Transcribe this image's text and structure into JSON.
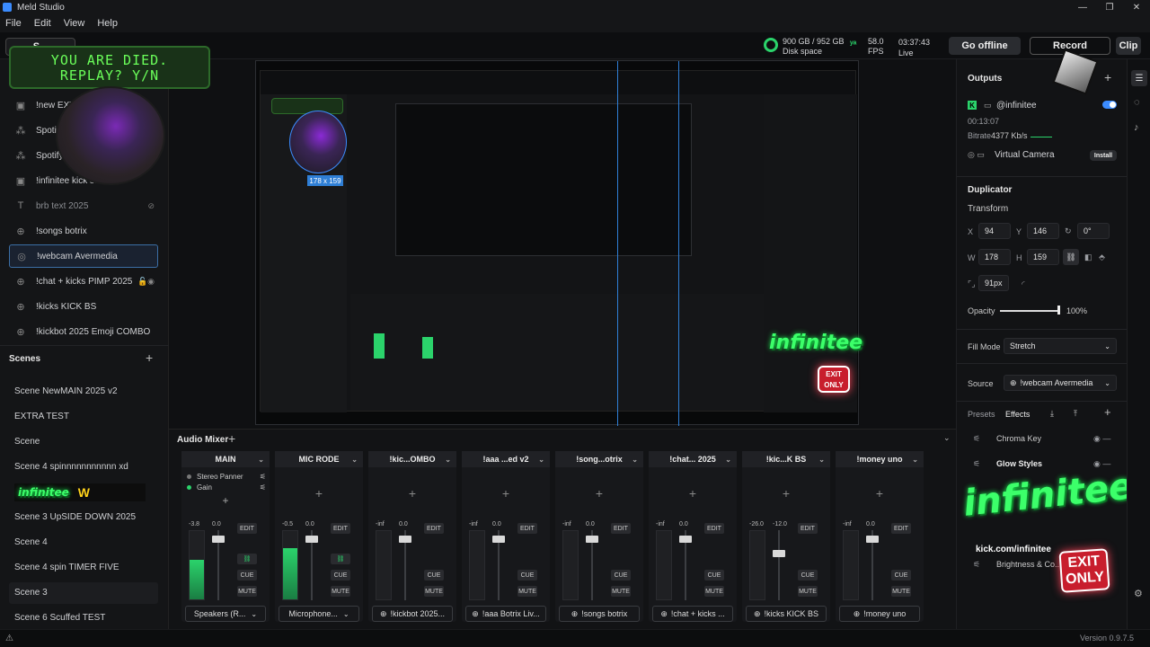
{
  "app": {
    "title": "Meld Studio"
  },
  "window_controls": [
    "—",
    "❐",
    "✕"
  ],
  "menu": [
    "File",
    "Edit",
    "View",
    "Help"
  ],
  "topbar": {
    "scene_button": "S...",
    "disk_value": "900 GB / 952 GB",
    "disk_label": "Disk space",
    "fps_value": "58.0",
    "fps_label": "FPS",
    "live_time": "03:37:43",
    "live_label": "Live",
    "go_offline": "Go offline",
    "record": "Record",
    "clip": "Clip"
  },
  "overlay": {
    "game_over_line1": "YOU ARE DIED.",
    "game_over_line2": "REPLAY? Y/N",
    "brand_text": "infinitee",
    "brand_url": "kick.com/infinitee",
    "exit_line1": "EXIT",
    "exit_line2": "ONLY"
  },
  "sources": [
    {
      "label": "!new EXTRA...",
      "icon": "layers-icon"
    },
    {
      "label": "Spotify",
      "icon": "grid-icon"
    },
    {
      "label": "Spotify...",
      "icon": "grid-icon"
    },
    {
      "label": "!infinitee kick sub...",
      "icon": "layers-icon"
    },
    {
      "label": "brb text 2025",
      "icon": "text-icon"
    },
    {
      "label": "!songs botrix",
      "icon": "globe-icon"
    },
    {
      "label": "!webcam Avermedia",
      "icon": "camera-icon"
    },
    {
      "label": "!chat + kicks PIMP 2025",
      "icon": "globe-icon"
    },
    {
      "label": "!kicks KICK BS",
      "icon": "globe-icon"
    },
    {
      "label": "!kickbot 2025 Emoji COMBO",
      "icon": "globe-icon"
    }
  ],
  "scenes": {
    "title": "Scenes",
    "items": [
      "Scene NewMAIN 2025 v2",
      "EXTRA TEST",
      "Scene",
      "Scene 4 spinnnnnnnnnnn xd",
      "",
      "Scene 3 UpSIDE DOWN 2025",
      "Scene 4",
      "Scene 4 spin TIMER FIVE",
      "Scene 3",
      "Scene 6 Scuffed TEST"
    ],
    "selected_index": 8
  },
  "preview": {
    "size_badge": "178 x 159"
  },
  "mixer": {
    "title": "Audio Mixer",
    "main_rows": [
      "Stereo Panner",
      "Gain"
    ],
    "edit": "EDIT",
    "cue": "CUE",
    "mute": "MUTE",
    "strips": [
      {
        "name": "MAIN",
        "peak": "-3.8",
        "level": "0.0",
        "fill": 0.58,
        "footer": "Speakers (R...",
        "fader": 0.92
      },
      {
        "name": "MIC RODE",
        "peak": "-0.5",
        "level": "0.0",
        "fill": 0.75,
        "footer": "Microphone...",
        "fader": 0.92
      },
      {
        "name": "!kic...OMBO",
        "peak": "-inf",
        "level": "0.0",
        "fill": 0.0,
        "footer": "!kickbot 2025...",
        "fader": 0.92
      },
      {
        "name": "!aaa ...ed v2",
        "peak": "-inf",
        "level": "0.0",
        "fill": 0.0,
        "footer": "!aaa Botrix Liv...",
        "fader": 0.92
      },
      {
        "name": "!song...otrix",
        "peak": "-inf",
        "level": "0.0",
        "fill": 0.0,
        "footer": "!songs botrix",
        "fader": 0.92
      },
      {
        "name": "!chat... 2025",
        "peak": "-inf",
        "level": "0.0",
        "fill": 0.0,
        "footer": "!chat + kicks ...",
        "fader": 0.92
      },
      {
        "name": "!kic...K BS",
        "peak": "-26.0",
        "level": "-12.0",
        "fill": 0.0,
        "footer": "!kicks KICK BS",
        "fader": 0.72
      },
      {
        "name": "!money uno",
        "peak": "-inf",
        "level": "0.0",
        "fill": 0.0,
        "footer": "!money uno",
        "fader": 0.92
      }
    ]
  },
  "outputs": {
    "title": "Outputs",
    "account": "@infinitee",
    "uptime": "00:13:07",
    "bitrate_label": "Bitrate",
    "bitrate_value": "4377 Kb/s",
    "virtual_camera": "Virtual Camera",
    "install": "Install"
  },
  "duplicator": {
    "title": "Duplicator",
    "transform": "Transform",
    "x_label": "X",
    "x": "94",
    "y_label": "Y",
    "y": "146",
    "rot": "0°",
    "w_label": "W",
    "w": "178",
    "h_label": "H",
    "h": "159",
    "radius": "91px",
    "opacity_label": "Opacity",
    "opacity_value": "100%",
    "opacity_fraction": 1.0,
    "fill_mode_label": "Fill Mode",
    "fill_mode": "Stretch",
    "source_label": "Source",
    "source_value": "!webcam Avermedia",
    "presets": "Presets",
    "effects": "Effects",
    "effect_items": [
      "Chroma Key",
      "Glow Styles",
      "",
      "Brightness & Co..."
    ]
  },
  "status": {
    "version": "Version 0.9.7.5"
  },
  "colors": {
    "accent": "#3b8cff",
    "meter_green": "#2bd36b",
    "brand_green": "#3cff6a",
    "exit_red": "#c81e2d"
  }
}
